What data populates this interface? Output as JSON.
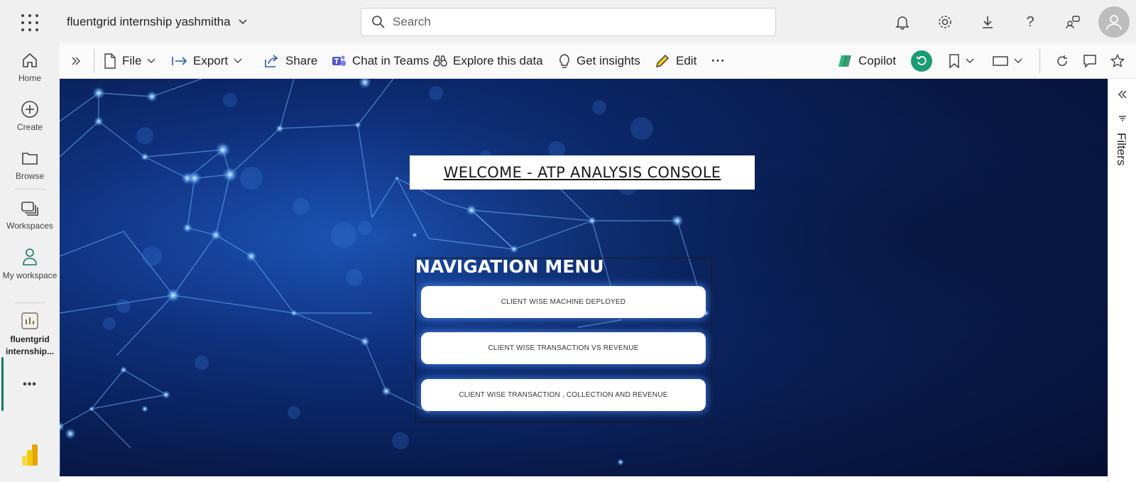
{
  "topbar": {
    "workspace_title": "fluentgrid internship yashmitha",
    "search_placeholder": "Search"
  },
  "rail": {
    "items": [
      {
        "label": "Home",
        "icon": "home-icon"
      },
      {
        "label": "Create",
        "icon": "plus-circle-icon"
      },
      {
        "label": "Browse",
        "icon": "folder-icon"
      },
      {
        "label": "Workspaces",
        "icon": "workspaces-icon"
      },
      {
        "label": "My workspace",
        "icon": "person-icon"
      },
      {
        "label": "fluentgrid internship...",
        "icon": "report-icon"
      }
    ],
    "more_label": "•••"
  },
  "toolbar": {
    "file": "File",
    "export": "Export",
    "share": "Share",
    "chat_in_teams": "Chat in Teams",
    "explore": "Explore this data",
    "insights": "Get insights",
    "edit": "Edit",
    "more": "···",
    "copilot": "Copilot"
  },
  "report": {
    "welcome_title": "WELCOME - ATP ANALYSIS CONSOLE",
    "nav_title": "NAVIGATION MENU",
    "nav_buttons": [
      "CLIENT WISE MACHINE DEPLOYED",
      "CLIENT WISE TRANSACTION VS REVENUE",
      "CLIENT WISE TRANSACTION , COLLECTION AND REVENUE"
    ]
  },
  "filters": {
    "label": "Filters"
  },
  "colors": {
    "accent": "#117865",
    "canvas_bg": "#0e2f7a",
    "copilot_green": "#1a9b72"
  }
}
